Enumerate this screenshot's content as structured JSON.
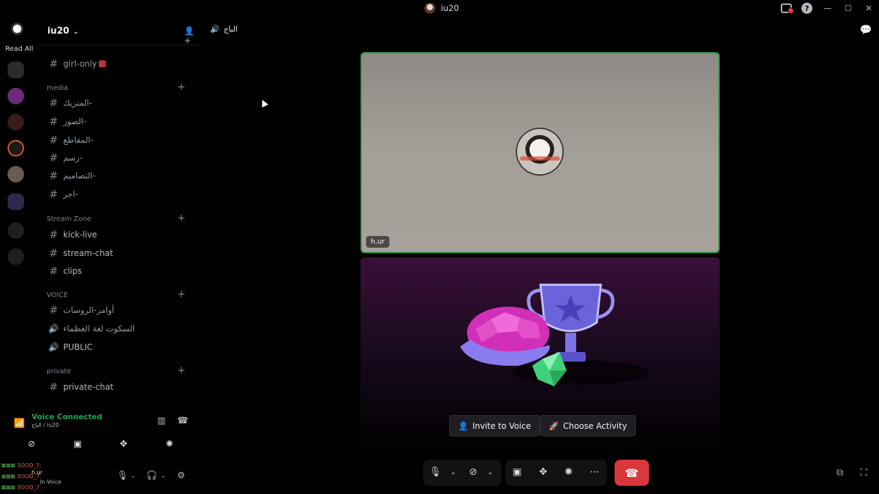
{
  "window": {
    "title": "iu20",
    "icons": [
      "inbox-icon",
      "help-icon",
      "minimize-icon",
      "maximize-icon",
      "close-icon"
    ]
  },
  "rail": {
    "read_all": "Read All"
  },
  "guild": {
    "name": "iu20"
  },
  "channels_top": [
    {
      "name": "girl-only",
      "emoji_color": "#c0304a"
    }
  ],
  "categories": {
    "media": "media",
    "stream_zone": "Stream Zone",
    "voice": "VOICE",
    "private": "private"
  },
  "media_channels": [
    {
      "name": "المتريك-"
    },
    {
      "name": "الصور-"
    },
    {
      "name": "المقاطع-"
    },
    {
      "name": "رسم-"
    },
    {
      "name": "التصاميم-"
    },
    {
      "name": "اجر-"
    }
  ],
  "stream_channels": [
    {
      "name": "kick-live"
    },
    {
      "name": "stream-chat"
    },
    {
      "name": "clips"
    }
  ],
  "voice_channels": [
    {
      "name": "أوامر-الروسات",
      "type": "text"
    },
    {
      "name": "السكوت لغة العظماء",
      "type": "voice"
    },
    {
      "name": "PUBLIC",
      "type": "voice"
    }
  ],
  "private_channels": [
    {
      "name": "private-chat"
    }
  ],
  "voice_status": {
    "title": "Voice Connected",
    "subtitle": "الباج / iu20"
  },
  "overlay_lines": [
    "3OOD_7: ",
    "3OOD_7: ",
    "3OOD_7: "
  ],
  "overlay_names": {
    "user": "h.ur",
    "status": "In Voice"
  },
  "main": {
    "channel_title": "الباج",
    "tile_name": "h.ur",
    "invite_label": "Invite to Voice",
    "activity_label": "Choose Activity"
  },
  "colors": {
    "accent_green": "#23a55a",
    "speaking_border": "#2f9e4e",
    "end_call": "#da373c"
  }
}
